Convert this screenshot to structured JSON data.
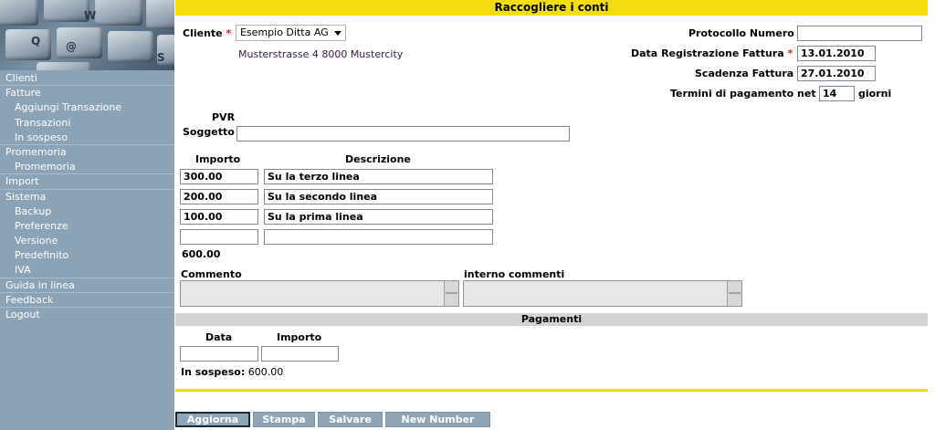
{
  "page_title": "Raccogliere i conti",
  "logo": {
    "keys": [
      "Q",
      "W",
      "@",
      "S"
    ]
  },
  "sidebar": {
    "items": [
      {
        "label": "Clienti",
        "level": 0
      },
      {
        "label": "Fatture",
        "level": 0
      },
      {
        "label": "Aggiungi Transazione",
        "level": 1
      },
      {
        "label": "Transazioni",
        "level": 1
      },
      {
        "label": "In sospeso",
        "level": 1
      },
      {
        "label": "Promemoria",
        "level": 0
      },
      {
        "label": "Promemoria",
        "level": 1
      },
      {
        "label": "Import",
        "level": 0
      },
      {
        "label": "Sistema",
        "level": 0
      },
      {
        "label": "Backup",
        "level": 1
      },
      {
        "label": "Preferenze",
        "level": 1
      },
      {
        "label": "Versione",
        "level": 1
      },
      {
        "label": "Predefinito",
        "level": 1
      },
      {
        "label": "IVA",
        "level": 1
      },
      {
        "label": "Guida in linea",
        "level": 0
      },
      {
        "label": "Feedback",
        "level": 0
      },
      {
        "label": "Logout",
        "level": 0
      }
    ]
  },
  "form": {
    "cliente_label": "Cliente",
    "cliente_value": "Esempio Ditta AG",
    "address": "Musterstrasse 4 8000 Mustercity",
    "protocollo_label": "Protocollo Numero",
    "protocollo_value": "",
    "data_reg_label": "Data Registrazione Fattura",
    "data_reg_value": "13.01.2010",
    "scadenza_label": "Scadenza Fattura",
    "scadenza_value": "27.01.2010",
    "termini_label": "Termini di pagamento net",
    "termini_value": "14",
    "termini_suffix": "giorni",
    "pvr_label": "PVR",
    "soggetto_label": "Soggetto",
    "soggetto_value": "",
    "required_mark": "*"
  },
  "lines": {
    "importo_header": "Importo",
    "descrizione_header": "Descrizione",
    "rows": [
      {
        "importo": "300.00",
        "descrizione": "Su la terzo linea"
      },
      {
        "importo": "200.00",
        "descrizione": "Su la secondo linea"
      },
      {
        "importo": "100.00",
        "descrizione": "Su la prima linea"
      },
      {
        "importo": "",
        "descrizione": ""
      }
    ],
    "total": "600.00"
  },
  "comments": {
    "commento_label": "Commento",
    "interno_label": "interno commenti"
  },
  "payments": {
    "header": "Pagamenti",
    "data_label": "Data",
    "importo_label": "Importo",
    "data_value": "",
    "importo_value": "",
    "sospeso_label": "In sospeso:",
    "sospeso_value": "600.00"
  },
  "buttons": {
    "aggiorna": "Aggiorna",
    "stampa": "Stampa",
    "salvare": "Salvare",
    "new_number": "New Number"
  },
  "colors": {
    "sidebar_bg": "#8aa3b6",
    "title_bar": "#f3dd0e",
    "section_bar": "#d3d3d3",
    "required": "#dd2222",
    "button_bg": "#8fa4b6"
  }
}
